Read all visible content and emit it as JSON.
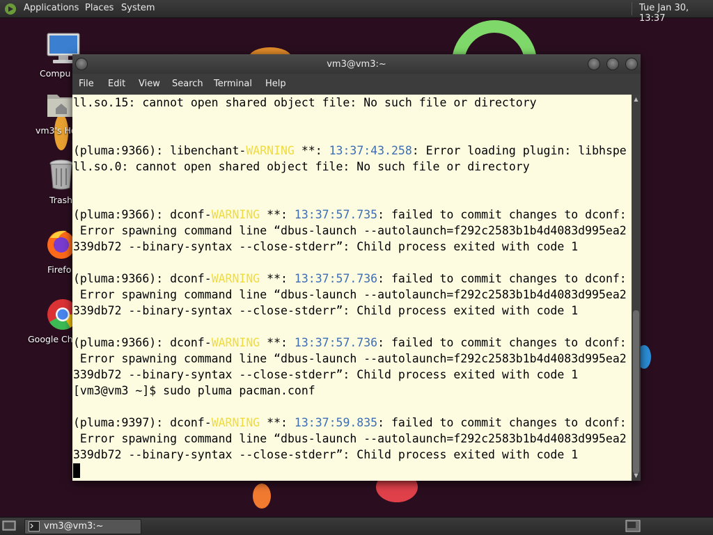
{
  "top_panel": {
    "menus": [
      "Applications",
      "Places",
      "System"
    ],
    "clock": "Tue Jan 30, 13:37"
  },
  "desktop_icons": [
    {
      "label": "Compu",
      "icon": "computer-icon"
    },
    {
      "label": "vm3's Ho",
      "icon": "home-folder-icon"
    },
    {
      "label": "Trash",
      "icon": "trash-icon"
    },
    {
      "label": "Firefo",
      "icon": "firefox-icon"
    },
    {
      "label": "Google Ch",
      "icon": "chrome-icon"
    }
  ],
  "window": {
    "title": "vm3@vm3:~",
    "menus": [
      "File",
      "Edit",
      "View",
      "Search",
      "Terminal",
      "Help"
    ]
  },
  "terminal": {
    "lines": [
      [
        {
          "t": "ll.so.15: cannot open shared object file: No such file or directory"
        }
      ],
      [
        {
          "t": ""
        }
      ],
      [
        {
          "t": ""
        }
      ],
      [
        {
          "t": "(pluma:9366): libenchant-"
        },
        {
          "t": "WARNING",
          "c": "warn"
        },
        {
          "t": " **: "
        },
        {
          "t": "13:37:43.258",
          "c": "time"
        },
        {
          "t": ": Error loading plugin: libhspe"
        }
      ],
      [
        {
          "t": "ll.so.0: cannot open shared object file: No such file or directory"
        }
      ],
      [
        {
          "t": ""
        }
      ],
      [
        {
          "t": ""
        }
      ],
      [
        {
          "t": "(pluma:9366): dconf-"
        },
        {
          "t": "WARNING",
          "c": "warn"
        },
        {
          "t": " **: "
        },
        {
          "t": "13:37:57.735",
          "c": "time"
        },
        {
          "t": ": failed to commit changes to dconf:"
        }
      ],
      [
        {
          "t": " Error spawning command line “dbus-launch --autolaunch=f292c2583b1b4d4083d995ea2"
        }
      ],
      [
        {
          "t": "339db72 --binary-syntax --close-stderr”: Child process exited with code 1"
        }
      ],
      [
        {
          "t": ""
        }
      ],
      [
        {
          "t": "(pluma:9366): dconf-"
        },
        {
          "t": "WARNING",
          "c": "warn"
        },
        {
          "t": " **: "
        },
        {
          "t": "13:37:57.736",
          "c": "time"
        },
        {
          "t": ": failed to commit changes to dconf:"
        }
      ],
      [
        {
          "t": " Error spawning command line “dbus-launch --autolaunch=f292c2583b1b4d4083d995ea2"
        }
      ],
      [
        {
          "t": "339db72 --binary-syntax --close-stderr”: Child process exited with code 1"
        }
      ],
      [
        {
          "t": ""
        }
      ],
      [
        {
          "t": "(pluma:9366): dconf-"
        },
        {
          "t": "WARNING",
          "c": "warn"
        },
        {
          "t": " **: "
        },
        {
          "t": "13:37:57.736",
          "c": "time"
        },
        {
          "t": ": failed to commit changes to dconf:"
        }
      ],
      [
        {
          "t": " Error spawning command line “dbus-launch --autolaunch=f292c2583b1b4d4083d995ea2"
        }
      ],
      [
        {
          "t": "339db72 --binary-syntax --close-stderr”: Child process exited with code 1"
        }
      ],
      [
        {
          "t": "[vm3@vm3 ~]$ sudo pluma pacman.conf"
        }
      ],
      [
        {
          "t": ""
        }
      ],
      [
        {
          "t": "(pluma:9397): dconf-"
        },
        {
          "t": "WARNING",
          "c": "warn"
        },
        {
          "t": " **: "
        },
        {
          "t": "13:37:59.835",
          "c": "time"
        },
        {
          "t": ": failed to commit changes to dconf:"
        }
      ],
      [
        {
          "t": " Error spawning command line “dbus-launch --autolaunch=f292c2583b1b4d4083d995ea2"
        }
      ],
      [
        {
          "t": "339db72 --binary-syntax --close-stderr”: Child process exited with code 1"
        }
      ]
    ]
  },
  "taskbar": {
    "tasks": [
      {
        "label": "vm3@vm3:~",
        "icon": "terminal-icon"
      }
    ]
  },
  "colors": {
    "terminal_bg": "#fdfce1",
    "warning": "#f0dc3c",
    "timestamp": "#3d6db5"
  }
}
